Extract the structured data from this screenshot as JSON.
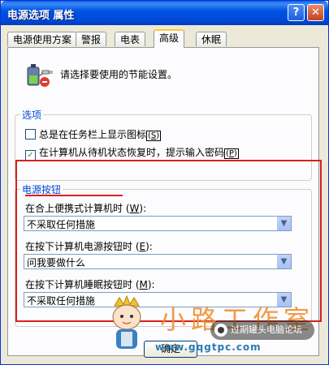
{
  "window": {
    "title": "电源选项 属性",
    "help_glyph": "?",
    "close_glyph": "✕"
  },
  "tabs": [
    {
      "label": "电源使用方案",
      "active": false
    },
    {
      "label": "警报",
      "active": false
    },
    {
      "label": "电表",
      "active": false
    },
    {
      "label": "高级",
      "active": true
    },
    {
      "label": "休眠",
      "active": false
    }
  ],
  "intro_text": "请选择要使用的节能设置。",
  "options": {
    "title": "选项",
    "items": [
      {
        "label": "总是在任务栏上显示图标",
        "key": "S",
        "checked": false
      },
      {
        "label": "在计算机从待机状态恢复时，提示输入密码",
        "key": "P",
        "checked": true
      }
    ]
  },
  "power_buttons": {
    "title": "电源按钮",
    "fields": [
      {
        "label": "在合上便携式计算机时",
        "key": "W",
        "value": "不采取任何措施"
      },
      {
        "label": "在按下计算机电源按钮时",
        "key": "E",
        "value": "问我要做什么"
      },
      {
        "label": "在按下计算机睡眠按钮时",
        "key": "M",
        "value": "不采取任何措施"
      }
    ]
  },
  "ok_button": "确定",
  "icons": {
    "battery": "battery-plug-icon",
    "dropdown": "chevron-down-icon"
  },
  "watermark": {
    "text": "小路工作室",
    "url": "www.gqgtpc.com",
    "badge": "过期罐头电脑论坛"
  },
  "colors": {
    "title_bar": "#0054e3",
    "highlight": "#d82020",
    "group_title": "#0046d5"
  }
}
